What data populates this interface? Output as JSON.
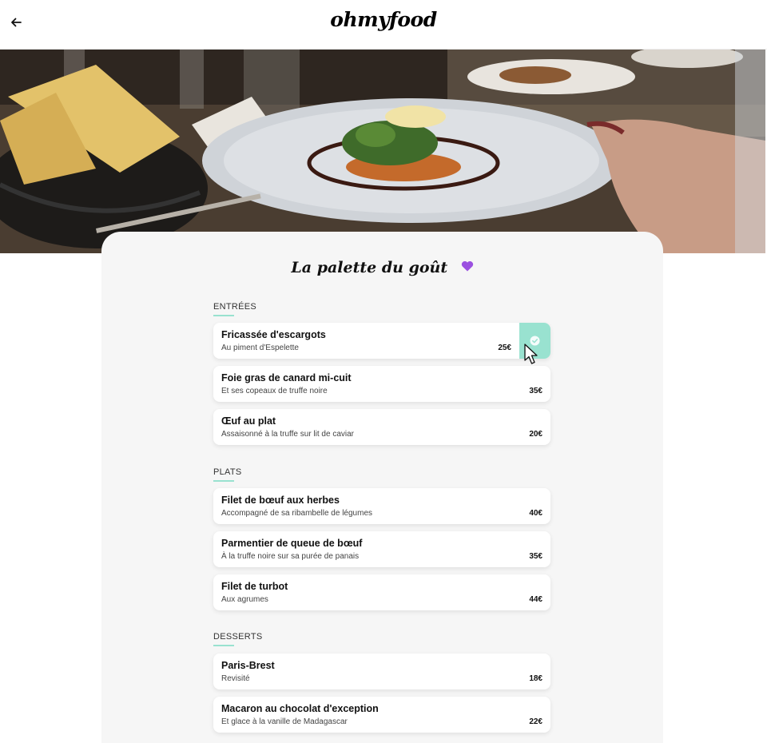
{
  "header": {
    "logo": "ohmyfood"
  },
  "hero": {
    "alt": "restaurant table with a plated fish dish and bread basket"
  },
  "restaurant": {
    "name": "La palette du goût"
  },
  "sections": [
    {
      "title": "ENTRÉES",
      "dishes": [
        {
          "name": "Fricassée d'escargots",
          "desc": "Au piment d'Espelette",
          "price": "25€",
          "selected": true
        },
        {
          "name": "Foie gras de canard mi-cuit",
          "desc": "Et ses copeaux de truffe noire",
          "price": "35€",
          "selected": false
        },
        {
          "name": "Œuf au plat",
          "desc": "Assaisonné à la truffe sur lit de caviar",
          "price": "20€",
          "selected": false
        }
      ]
    },
    {
      "title": "PLATS",
      "dishes": [
        {
          "name": "Filet de bœuf aux herbes",
          "desc": "Accompagné de sa ribambelle de légumes",
          "price": "40€",
          "selected": false
        },
        {
          "name": "Parmentier de queue de bœuf",
          "desc": "À la truffe noire sur sa purée de panais",
          "price": "35€",
          "selected": false
        },
        {
          "name": "Filet de turbot",
          "desc": "Aux agrumes",
          "price": "44€",
          "selected": false
        }
      ]
    },
    {
      "title": "DESSERTS",
      "dishes": [
        {
          "name": "Paris-Brest",
          "desc": "Revisité",
          "price": "18€",
          "selected": false
        },
        {
          "name": "Macaron au chocolat d'exception",
          "desc": "Et glace à la vanille de Madagascar",
          "price": "22€",
          "selected": false
        }
      ]
    }
  ],
  "colors": {
    "accent": "#99e2d0",
    "heart": "#9b51e0",
    "card_bg": "#f6f6f6"
  },
  "icons": {
    "back": "arrow-left-icon",
    "favorite": "heart-icon",
    "check": "check-circle-icon",
    "cursor": "mouse-cursor-icon"
  }
}
